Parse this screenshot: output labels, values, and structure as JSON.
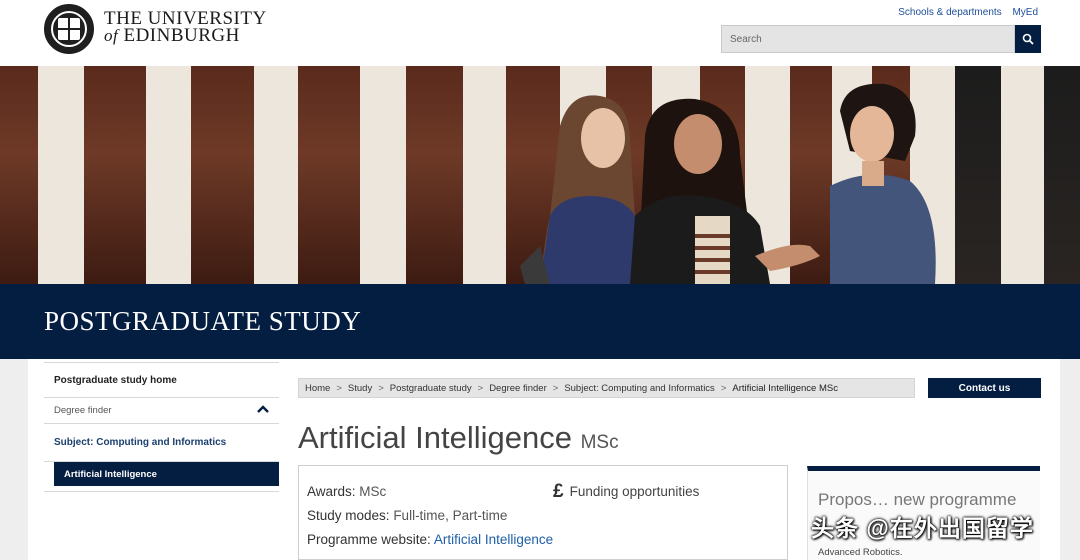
{
  "header": {
    "logo_line1": "THE UNIVERSITY",
    "logo_of": "of",
    "logo_line2": "EDINBURGH",
    "links": [
      "Schools & departments",
      "MyEd"
    ],
    "search_placeholder": "Search"
  },
  "banner": {
    "title": "POSTGRADUATE STUDY"
  },
  "sidebar": {
    "home": "Postgraduate study home",
    "finder": "Degree finder",
    "subject": "Subject: Computing and Informatics",
    "active": "Artificial Intelligence"
  },
  "breadcrumb": [
    "Home",
    "Study",
    "Postgraduate study",
    "Degree finder",
    "Subject: Computing and Informatics",
    "Artificial Intelligence MSc"
  ],
  "contact_button": "Contact us",
  "page_title": {
    "main": "Artificial Intelligence",
    "suffix": "MSc"
  },
  "info": {
    "awards_label": "Awards:",
    "awards_value": "MSc",
    "modes_label": "Study modes:",
    "modes_value": "Full-time, Part-time",
    "website_label": "Programme website:",
    "website_link": "Artificial Intelligence",
    "funding_icon": "£",
    "funding": "Funding opportunities"
  },
  "proposed": {
    "title": "Propos… new programme",
    "text": "Advanced Robotics."
  },
  "watermark": "头条 @在外出国留学",
  "colors": {
    "navy": "#041e42",
    "link": "#1f5fa8"
  }
}
